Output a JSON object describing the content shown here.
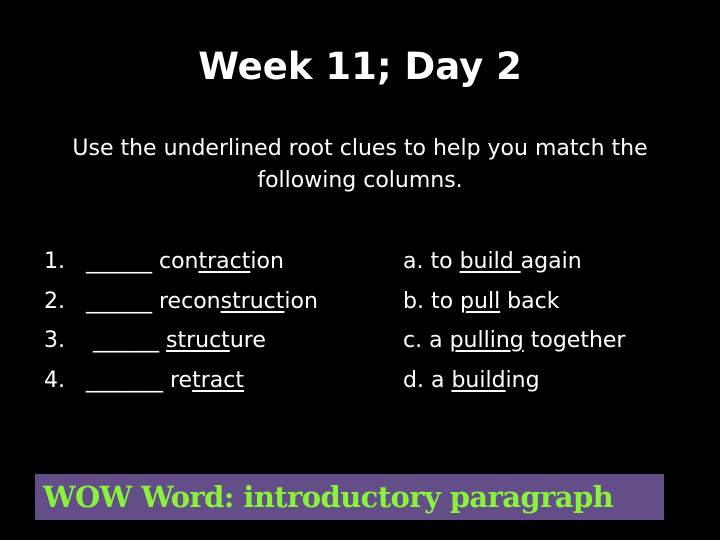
{
  "slide": {
    "title": "Week 11; Day 2",
    "instructions": "Use the underlined root clues to help you match the following columns.",
    "left_items": [
      {
        "number": "1.",
        "blank": "______",
        "parts": [
          {
            "text": "con",
            "underline": false
          },
          {
            "text": "tract",
            "underline": true
          },
          {
            "text": "ion",
            "underline": false
          }
        ]
      },
      {
        "number": "2.",
        "blank": "______",
        "parts": [
          {
            "text": "recon",
            "underline": false
          },
          {
            "text": "struct",
            "underline": true
          },
          {
            "text": "ion",
            "underline": false
          }
        ]
      },
      {
        "number": "3.",
        "blank": " ______",
        "parts": [
          {
            "text": "struct",
            "underline": true
          },
          {
            "text": "ure",
            "underline": false
          }
        ]
      },
      {
        "number": "4.",
        "blank": "_______",
        "parts": [
          {
            "text": "re",
            "underline": false
          },
          {
            "text": "tract",
            "underline": true
          }
        ]
      }
    ],
    "right_items": [
      {
        "letter": "a.",
        "parts": [
          {
            "text": "to ",
            "underline": false
          },
          {
            "text": "build ",
            "underline": true
          },
          {
            "text": "again",
            "underline": false
          }
        ]
      },
      {
        "letter": "b.",
        "parts": [
          {
            "text": "to ",
            "underline": false
          },
          {
            "text": "pull",
            "underline": true
          },
          {
            "text": " back",
            "underline": false
          }
        ]
      },
      {
        "letter": "c.",
        "parts": [
          {
            "text": "a ",
            "underline": false
          },
          {
            "text": "pulling",
            "underline": true
          },
          {
            "text": " together",
            "underline": false
          }
        ]
      },
      {
        "letter": "d.",
        "parts": [
          {
            "text": "a ",
            "underline": false
          },
          {
            "text": "build",
            "underline": true
          },
          {
            "text": "ing",
            "underline": false
          }
        ]
      }
    ],
    "wow_word": "WOW Word: introductory paragraph"
  },
  "colors": {
    "background": "#000000",
    "text": "#ffffff",
    "wow_box_background": "#634e87",
    "wow_text": "#8af23a"
  }
}
